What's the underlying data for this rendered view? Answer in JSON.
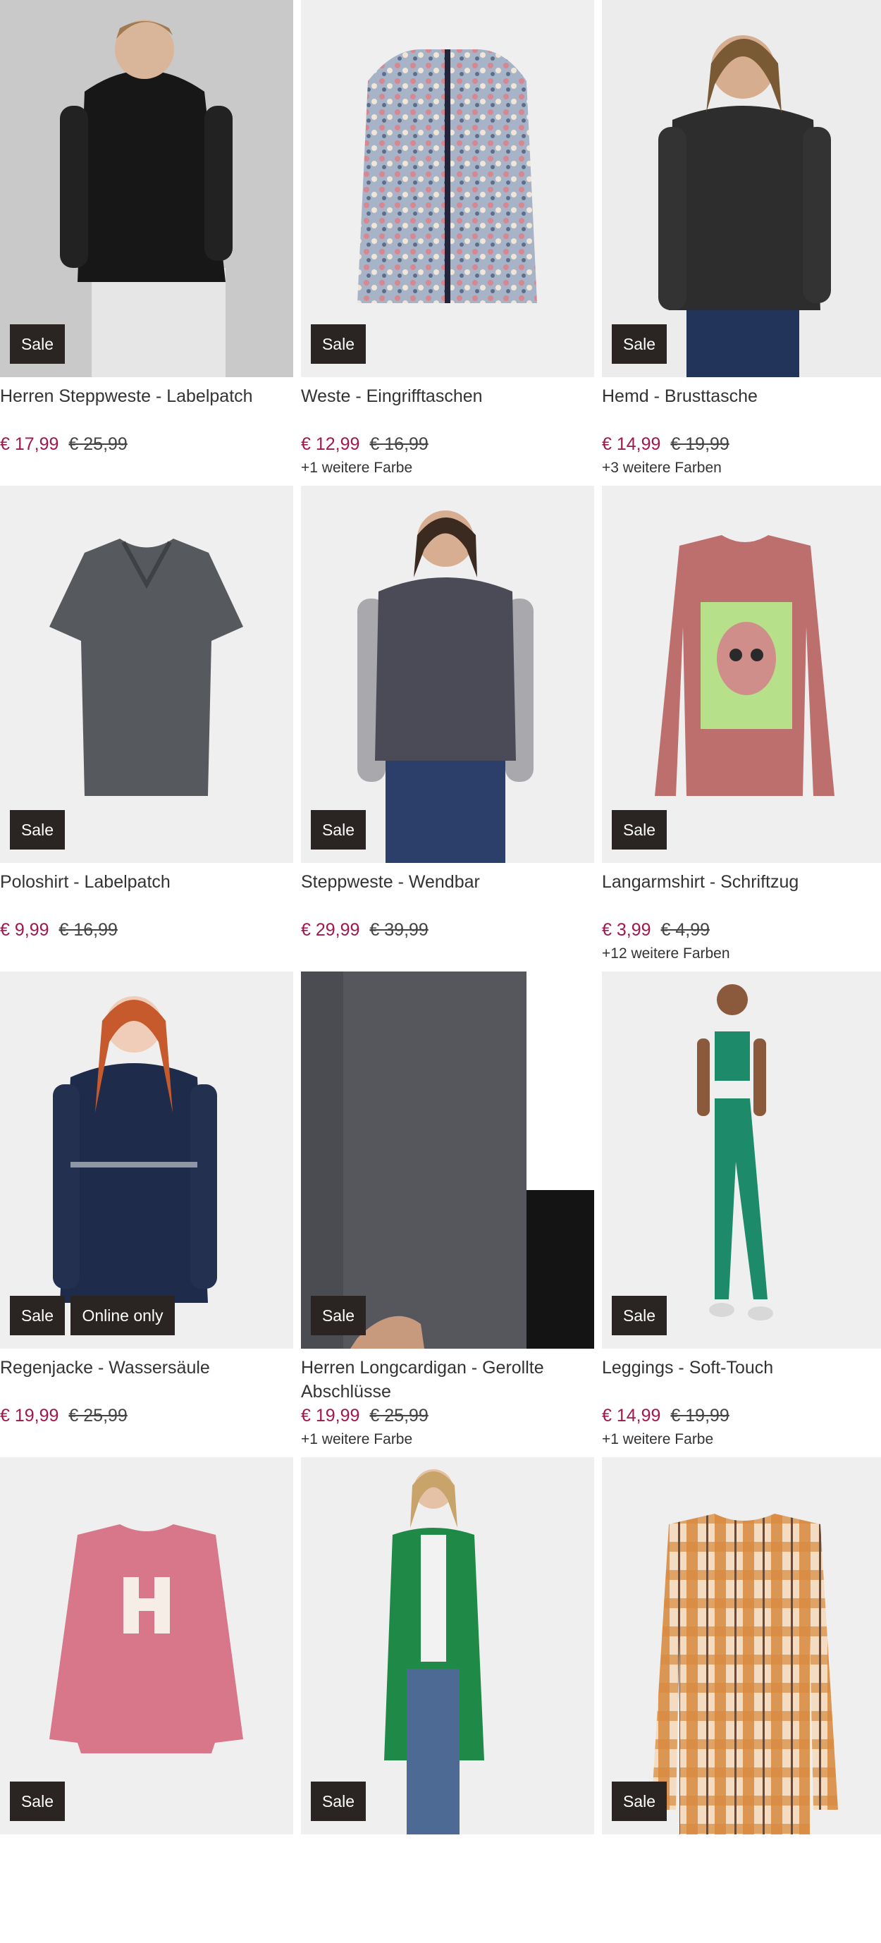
{
  "products": [
    {
      "title": "Herren Steppweste - Labelpatch",
      "price": "€ 17,99",
      "old_price": "€ 25,99",
      "colors": "",
      "badges": [
        "Sale"
      ]
    },
    {
      "title": "Weste - Eingrifftaschen",
      "price": "€ 12,99",
      "old_price": "€ 16,99",
      "colors": "+1 weitere Farbe",
      "badges": [
        "Sale"
      ]
    },
    {
      "title": "Hemd - Brusttasche",
      "price": "€ 14,99",
      "old_price": "€ 19,99",
      "colors": "+3 weitere Farben",
      "badges": [
        "Sale"
      ]
    },
    {
      "title": "Poloshirt - Labelpatch",
      "price": "€ 9,99",
      "old_price": "€ 16,99",
      "colors": "",
      "badges": [
        "Sale"
      ]
    },
    {
      "title": "Steppweste - Wendbar",
      "price": "€ 29,99",
      "old_price": "€ 39,99",
      "colors": "",
      "badges": [
        "Sale"
      ]
    },
    {
      "title": "Langarmshirt - Schriftzug",
      "price": "€ 3,99",
      "old_price": "€ 4,99",
      "colors": "+12 weitere Farben",
      "badges": [
        "Sale"
      ]
    },
    {
      "title": "Regenjacke - Wassersäule",
      "price": "€ 19,99",
      "old_price": "€ 25,99",
      "colors": "",
      "badges": [
        "Sale",
        "Online only"
      ]
    },
    {
      "title": "Herren Longcardigan - Gerollte Abschlüsse",
      "price": "€ 19,99",
      "old_price": "€ 25,99",
      "colors": "+1 weitere Farbe",
      "badges": [
        "Sale"
      ]
    },
    {
      "title": "Leggings - Soft-Touch",
      "price": "€ 14,99",
      "old_price": "€ 19,99",
      "colors": "+1 weitere Farbe",
      "badges": [
        "Sale"
      ]
    },
    {
      "title": "",
      "price": "",
      "old_price": "",
      "colors": "",
      "badges": [
        "Sale"
      ]
    },
    {
      "title": "",
      "price": "",
      "old_price": "",
      "colors": "",
      "badges": [
        "Sale"
      ]
    },
    {
      "title": "",
      "price": "",
      "old_price": "",
      "colors": "",
      "badges": [
        "Sale"
      ]
    }
  ],
  "colors": {
    "sale_price": "#a0184e",
    "badge_bg": "#2a2523",
    "image_bg": "#efefef"
  }
}
